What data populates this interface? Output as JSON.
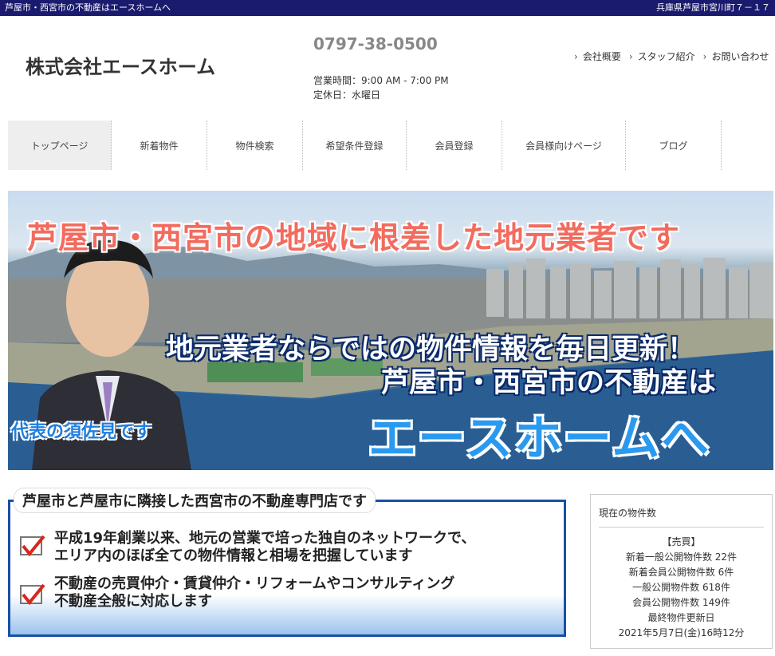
{
  "topbar": {
    "left": "芦屋市・西宮市の不動産はエースホームへ",
    "right": "兵庫県芦屋市宮川町７－１７"
  },
  "header": {
    "company": "株式会社エースホーム",
    "phone": "0797-38-0500",
    "hours": "営業時間：9:00 AM - 7:00 PM",
    "closed": "定休日：水曜日",
    "links": [
      "会社概要",
      "スタッフ紹介",
      "お問い合わせ"
    ]
  },
  "nav": {
    "items": [
      "トップページ",
      "新着物件",
      "物件検索",
      "希望条件登録",
      "会員登録",
      "会員様向けページ",
      "ブログ"
    ]
  },
  "hero": {
    "line1": "芦屋市・西宮市の地域に根差した地元業者です",
    "line2": "地元業者ならではの物件情報を毎日更新！",
    "line3": "芦屋市・西宮市の不動産は",
    "line4": "エースホームへ",
    "caption": "代表の須佐見です"
  },
  "info": {
    "title": "芦屋市と芦屋市に隣接した西宮市の不動産専門店です",
    "bullet1_line1": "平成19年創業以来、地元の営業で培った独自のネットワークで、",
    "bullet1_line2": "エリア内のほぼ全ての物件情報と相場を把握しています",
    "bullet2_line1": "不動産の売買仲介・賃貸仲介・リフォームやコンサルティング",
    "bullet2_line2": "不動産全般に対応します"
  },
  "stats": {
    "heading": "現在の物件数",
    "section": "【売買】",
    "new_public": "新着一般公開物件数 22件",
    "new_member": "新着会員公開物件数 6件",
    "public": "一般公開物件数 618件",
    "member": "会員公開物件数 149件",
    "updated_label": "最終物件更新日",
    "updated": "2021年5月7日(金)16時12分"
  }
}
